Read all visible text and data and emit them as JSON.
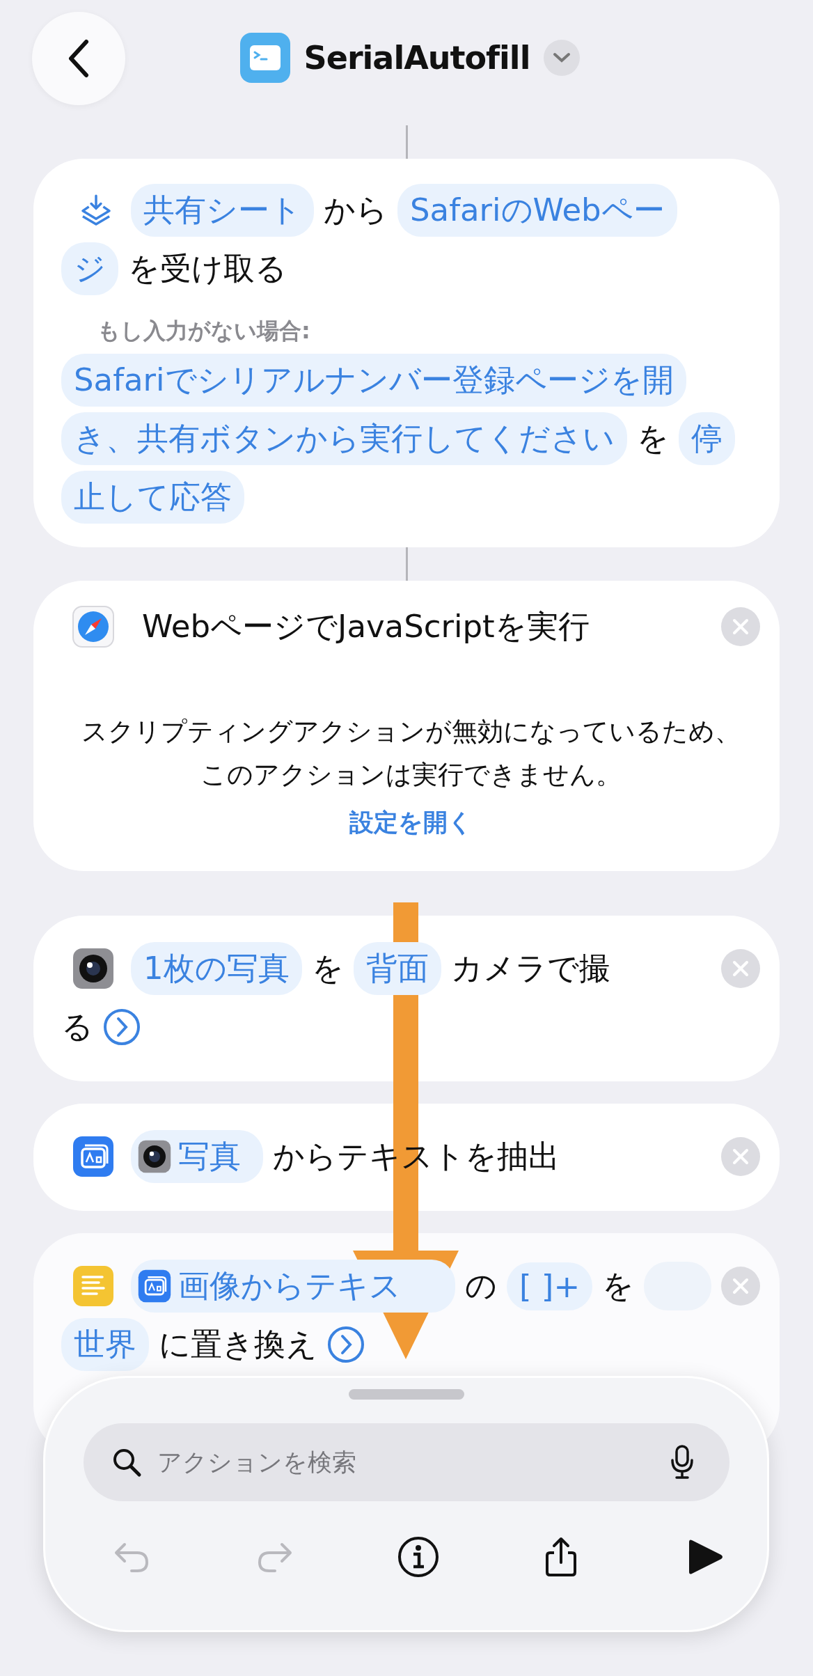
{
  "header": {
    "title": "SerialAutofill"
  },
  "actions": [
    {
      "kind": "share_sheet",
      "closable": false,
      "lines": [
        [
          {
            "kind": "token",
            "text": "共有シート"
          },
          {
            "kind": "text",
            "text": "から"
          },
          {
            "kind": "token",
            "text": "SafariのWebペー"
          }
        ],
        [
          {
            "kind": "token",
            "text": "ジ"
          },
          {
            "kind": "text",
            "text": "を受け取る"
          }
        ]
      ],
      "fallback": {
        "label": "もし入力がない場合:",
        "lines": [
          [
            {
              "kind": "token",
              "text": "Safariでシリアルナンバー登録ページを開"
            }
          ],
          [
            {
              "kind": "token",
              "text": "き、共有ボタンから実行してください"
            },
            {
              "kind": "text",
              "text": "を"
            },
            {
              "kind": "token",
              "text": "停"
            }
          ],
          [
            {
              "kind": "token",
              "text": "止して応答"
            }
          ]
        ]
      }
    },
    {
      "kind": "safari",
      "closable": true,
      "lines": [
        [
          {
            "kind": "text",
            "text": "WebページでJavaScriptを実行"
          }
        ]
      ],
      "message": "スクリプティングアクションが無効になっているため、このアクションは実行できません。",
      "link": "設定を開く"
    },
    {
      "kind": "camera",
      "closable": true,
      "lines": [
        [
          {
            "kind": "token",
            "text": "1枚の写真"
          },
          {
            "kind": "text",
            "text": "を"
          },
          {
            "kind": "token",
            "text": "背面"
          },
          {
            "kind": "text",
            "text": "カメラで撮"
          }
        ],
        [
          {
            "kind": "text",
            "text": "る"
          },
          {
            "kind": "more"
          }
        ]
      ]
    },
    {
      "kind": "text_recognition",
      "closable": true,
      "lines": [
        [
          {
            "kind": "result_token",
            "text": "写真"
          },
          {
            "kind": "text",
            "text": "からテキストを抽出"
          }
        ]
      ]
    },
    {
      "kind": "text",
      "closable": true,
      "lines": [
        [
          {
            "kind": "result_token",
            "text": "画像からテキス"
          },
          {
            "kind": "text",
            "text": "の"
          },
          {
            "kind": "token",
            "text": "[ ]+"
          },
          {
            "kind": "text",
            "text": "を"
          },
          {
            "kind": "empty"
          }
        ],
        [
          {
            "kind": "token",
            "text": "世界"
          },
          {
            "kind": "text",
            "text": "に置き換え"
          },
          {
            "kind": "more"
          }
        ]
      ]
    }
  ],
  "panel": {
    "search": {
      "placeholder": "アクションを検索"
    },
    "toolbar": [
      {
        "kind": "undo",
        "disabled": true
      },
      {
        "kind": "redo",
        "disabled": true
      },
      {
        "kind": "info",
        "disabled": false
      },
      {
        "kind": "share",
        "disabled": false
      },
      {
        "kind": "play",
        "disabled": false
      }
    ]
  }
}
